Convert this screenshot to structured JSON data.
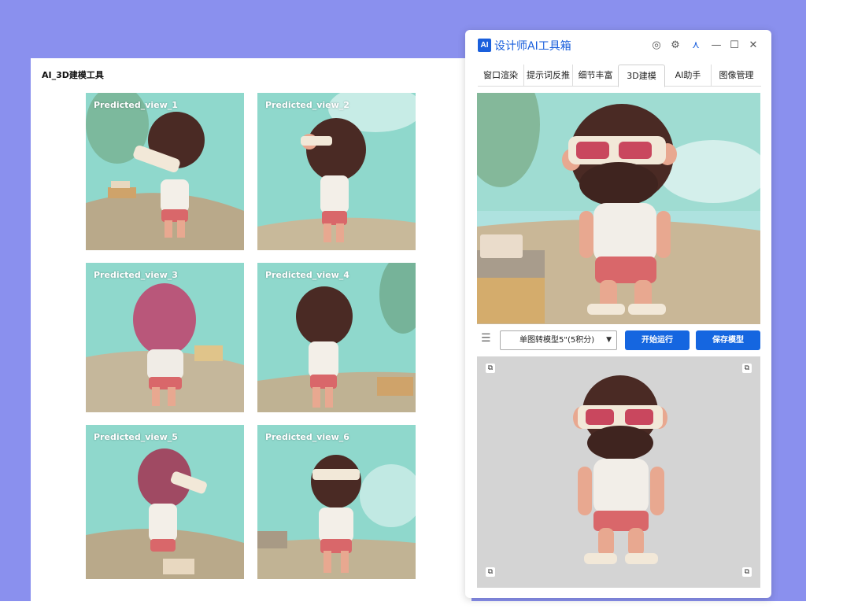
{
  "left_window": {
    "title": "AI_3D建模工具",
    "views": [
      {
        "label": "Predicted_view_1"
      },
      {
        "label": "Predicted_view_2"
      },
      {
        "label": "Predicted_view_3"
      },
      {
        "label": "Predicted_view_4"
      },
      {
        "label": "Predicted_view_5"
      },
      {
        "label": "Predicted_view_6"
      }
    ]
  },
  "right_window": {
    "logo_text": "AI",
    "title": "设计师AI工具箱",
    "tabs": [
      {
        "label": "窗口渲染"
      },
      {
        "label": "提示词反推"
      },
      {
        "label": "细节丰富"
      },
      {
        "label": "3D建模"
      },
      {
        "label": "AI助手"
      },
      {
        "label": "图像管理"
      }
    ],
    "active_tab": "3D建模",
    "model_select": "单图转模型5\"(5积分)",
    "run_button": "开始运行",
    "save_button": "保存模型"
  },
  "colors": {
    "backdrop": "#8a90ee",
    "accent_blue": "#1566e0",
    "sky": "#8fd8cc",
    "sand": "#b9a98a",
    "skin": "#e8a890",
    "hair": "#4a2a24",
    "shorts": "#d9676a"
  }
}
